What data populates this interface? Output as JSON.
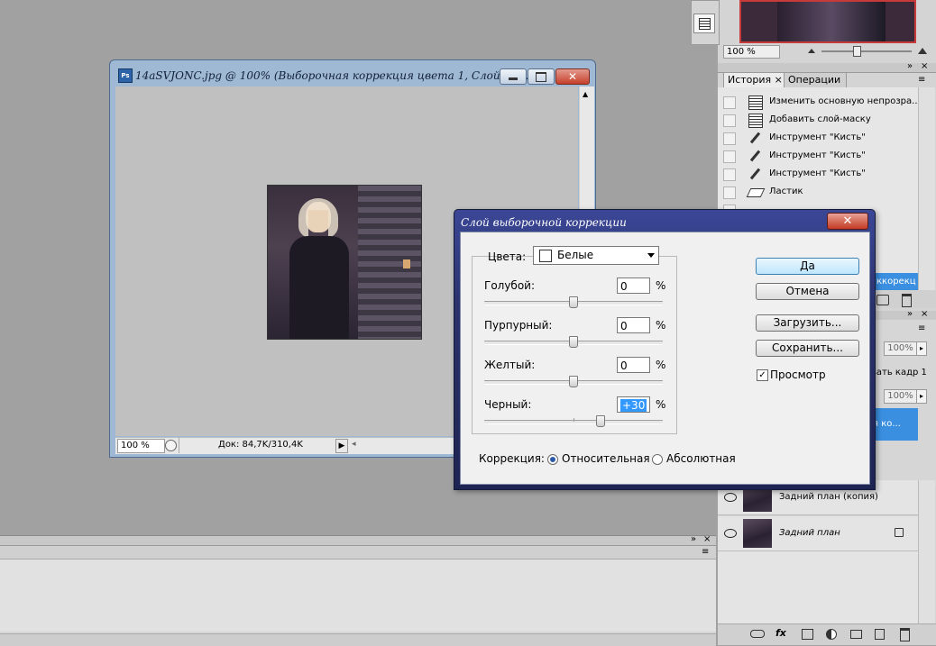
{
  "document": {
    "title": "14aSVJONC.jpg @ 100% (Выборочная коррекция цвета 1, Слой-мас...",
    "zoom": "100 %",
    "doc_info": "Док: 84,7K/310,4K"
  },
  "nav": {
    "zoom": "100 %"
  },
  "history": {
    "tabs": [
      "История",
      "Операции"
    ],
    "items": [
      "Изменить основную непрозра...",
      "Добавить слой-маску",
      "Инструмент \"Кисть\"",
      "Инструмент \"Кисть\"",
      "Инструмент \"Кисть\"",
      "Ластик"
    ]
  },
  "layers": {
    "opacity": "100%",
    "fill": "100%",
    "unify_text": "вать кадр 1",
    "selected_partial": "я ко...",
    "selected_partial2": "ккорекц",
    "rows": [
      "Задний план (копия)",
      "Задний план"
    ]
  },
  "dialog": {
    "title": "Слой выборочной коррекции",
    "colors_label": "Цвета:",
    "colors_value": "Белые",
    "sliders": [
      {
        "label": "Голубой:",
        "value": "0",
        "level": 0.5
      },
      {
        "label": "Пурпурный:",
        "value": "0",
        "level": 0.5
      },
      {
        "label": "Желтый:",
        "value": "0",
        "level": 0.5
      },
      {
        "label": "Черный:",
        "value": "+30",
        "level": 0.65
      }
    ],
    "percent": "%",
    "buttons": {
      "ok": "Да",
      "cancel": "Отмена",
      "load": "Загрузить...",
      "save": "Сохранить..."
    },
    "preview_label": "Просмотр",
    "correction_label": "Коррекция:",
    "relative_label": "Относительная",
    "absolute_label": "Абсолютная"
  }
}
